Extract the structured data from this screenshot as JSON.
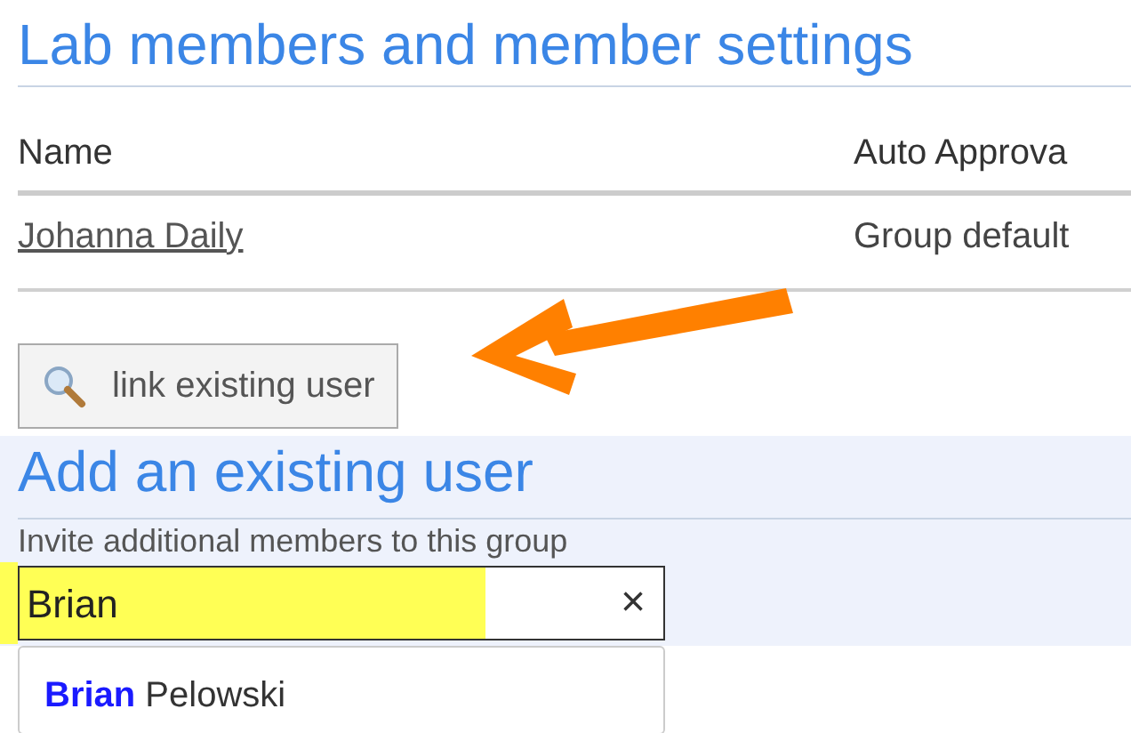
{
  "page_title": "Lab members and member settings",
  "table": {
    "columns": [
      "Name",
      "Auto Approva"
    ],
    "rows": [
      {
        "name": "Johanna Daily",
        "column_2": "Group default"
      }
    ]
  },
  "link_button": {
    "label": "link existing user"
  },
  "add_section": {
    "title": "Add an existing user",
    "description": "Invite additional members to this group",
    "search": {
      "value": "Brian",
      "clear": "×"
    },
    "suggestions": [
      "**Brian** Pelowski"
    ]
  }
}
